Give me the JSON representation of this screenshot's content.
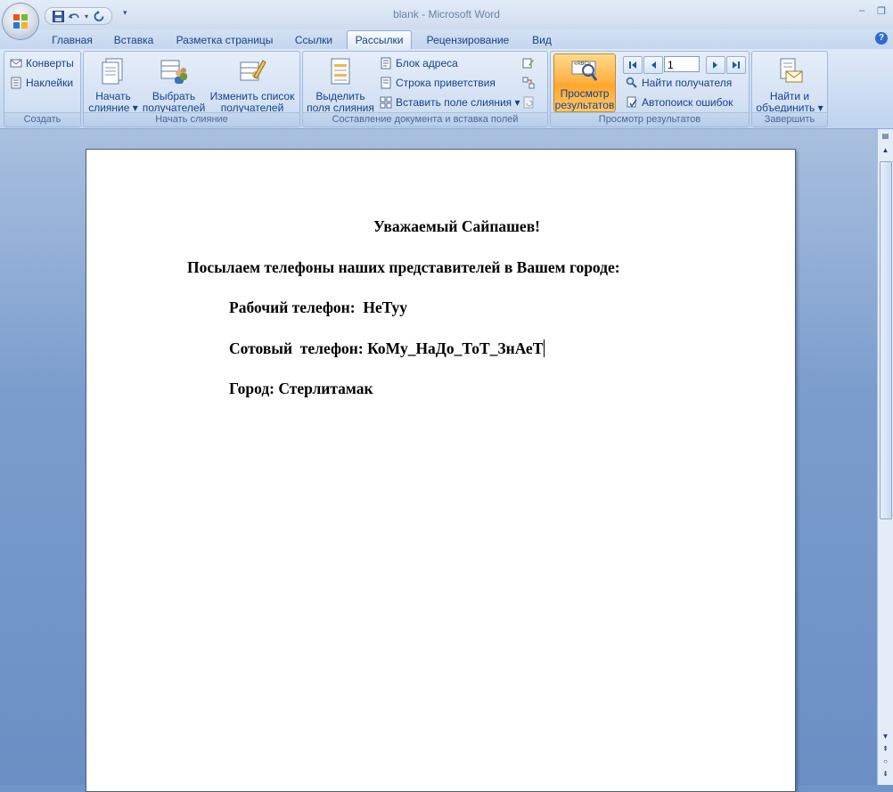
{
  "window": {
    "title": "blank - Microsoft Word",
    "controls": {
      "minimize": "–",
      "restore": "❐"
    }
  },
  "qat": {
    "save_icon": "save-icon",
    "undo_icon": "undo-icon",
    "redo_icon": "redo-icon",
    "customize": "▾"
  },
  "tabs": [
    {
      "label": "Главная"
    },
    {
      "label": "Вставка"
    },
    {
      "label": "Разметка страницы"
    },
    {
      "label": "Ссылки"
    },
    {
      "label": "Рассылки"
    },
    {
      "label": "Рецензирование"
    },
    {
      "label": "Вид"
    }
  ],
  "active_tab": "Рассылки",
  "ribbon": {
    "create": {
      "label": "Создать",
      "envelopes": "Конверты",
      "labels": "Наклейки"
    },
    "start_merge": {
      "label": "Начать слияние",
      "start": [
        "Начать",
        "слияние ▾"
      ],
      "select": [
        "Выбрать",
        "получателей ▾"
      ],
      "edit": [
        "Изменить список",
        "получателей"
      ]
    },
    "write_insert": {
      "label": "Составление документа и вставка полей",
      "highlight": [
        "Выделить",
        "поля слияния"
      ],
      "address_block": "Блок адреса",
      "greeting_line": "Строка приветствия",
      "insert_field": "Вставить поле слияния ▾"
    },
    "preview": {
      "label": "Просмотр результатов",
      "preview_btn": [
        "Просмотр",
        "результатов"
      ],
      "record": "1",
      "find_recipient": "Найти получателя",
      "auto_check": "Автопоиск ошибок",
      "abc": "«ABC»"
    },
    "finish": {
      "label": "Завершить",
      "finish_btn": [
        "Найти и",
        "объединить ▾"
      ]
    }
  },
  "document": {
    "greeting": "Уважаемый Сайпашев!",
    "intro": "Посылаем телефоны наших представителей в Вашем городе:",
    "work_phone_label": "Рабочий телефон:",
    "work_phone_value": "НеТуу",
    "mobile_label": "Сотовый  телефон:",
    "mobile_value": "КоМу_НаДо_ТоТ_ЗнАеТ",
    "city_label": "Город:",
    "city_value": "Стерлитамак"
  },
  "colors": {
    "accent": "#15428b",
    "preview_active": "#ffb347",
    "ribbon_bg": "#d1e0f3"
  }
}
